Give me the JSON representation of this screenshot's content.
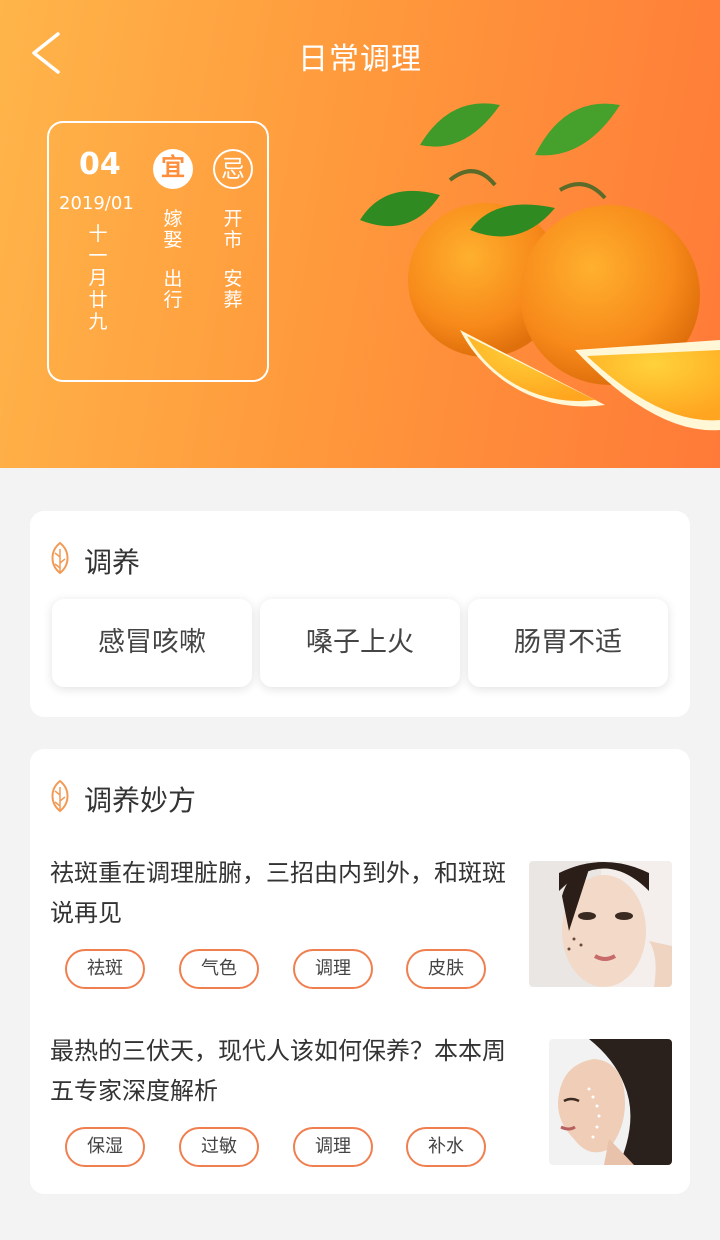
{
  "nav": {
    "title": "日常调理",
    "back_icon": "chevron-left-icon"
  },
  "calendar": {
    "day": "04",
    "date": "2019/01",
    "lunar": "十一月廿九",
    "yi_label": "宜",
    "ji_label": "忌",
    "yi_items": [
      "嫁娶",
      "出行"
    ],
    "ji_items": [
      "开市",
      "安葬"
    ]
  },
  "colors": {
    "accent": "#ff8d3a",
    "tag_border": "#f07f4f",
    "header_start": "#ffb54a",
    "header_end": "#ff7a38"
  },
  "section1": {
    "title": "调养",
    "chips": [
      "感冒咳嗽",
      "嗓子上火",
      "肠胃不适"
    ]
  },
  "section2": {
    "title": "调养妙方",
    "articles": [
      {
        "title": "祛斑重在调理脏腑，三招由内到外，和斑斑说再见",
        "tags": [
          "祛斑",
          "气色",
          "调理",
          "皮肤"
        ]
      },
      {
        "title": "最热的三伏天，现代人该如何保养？本本周五专家深度解析",
        "tags": [
          "保湿",
          "过敏",
          "调理",
          "补水"
        ]
      }
    ]
  }
}
